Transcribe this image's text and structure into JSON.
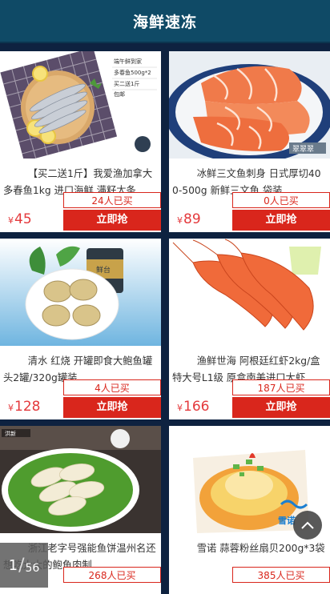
{
  "header": {
    "title": "海鲜速冻"
  },
  "currency": "¥",
  "products": [
    {
      "name": "【买二送1斤】我爱渔加拿大多春鱼1kg 进口海鲜 满籽太条",
      "price": "45",
      "sold": "24人已买",
      "buy_label": "立即抢",
      "image_icon": "capelin-fish-photo",
      "image_text": [
        "端午鲜到家",
        "多春鱼500g*2",
        "买二送1斤",
        "包邮"
      ]
    },
    {
      "name": "冰鲜三文鱼刺身 日式厚切400-500g 新鲜三文鱼 袋装",
      "price": "89",
      "sold": "0人已买",
      "buy_label": "立即抢",
      "image_icon": "salmon-sashimi-photo",
      "image_text": [
        "翠翠翠"
      ]
    },
    {
      "name": "清水 红烧 开罐即食大鲍鱼罐头2罐/320g罐装",
      "price": "128",
      "sold": "4人已买",
      "buy_label": "立即抢",
      "image_icon": "canned-abalone-photo",
      "image_text": [
        "鲜台"
      ]
    },
    {
      "name": "渔鲜世海 阿根廷红虾2kg/盒特大号L1级 原盒南美进口大虾",
      "price": "166",
      "sold": "187人已买",
      "buy_label": "立即抢",
      "image_icon": "argentine-red-shrimp-photo",
      "image_text": []
    },
    {
      "name": "浙江老字号强能鱼饼温州名还想吃大大的鲍鱼肉制",
      "price": "",
      "sold": "268人已买",
      "buy_label": "立即抢",
      "image_icon": "fish-cake-plate-photo",
      "image_text": [
        "洪新"
      ]
    },
    {
      "name": "雪诺 蒜蓉粉丝扇贝200g*3袋",
      "price": "",
      "sold": "385人已买",
      "buy_label": "立即抢",
      "image_icon": "garlic-scallop-photo",
      "image_text": [
        "雪诺"
      ]
    }
  ],
  "pager": {
    "current": "1",
    "separator": "/",
    "total": "56"
  },
  "colors": {
    "header_bg": "#0f4a66",
    "page_bg": "#0e2240",
    "accent_red": "#d9261c",
    "price_red": "#e4393c"
  }
}
